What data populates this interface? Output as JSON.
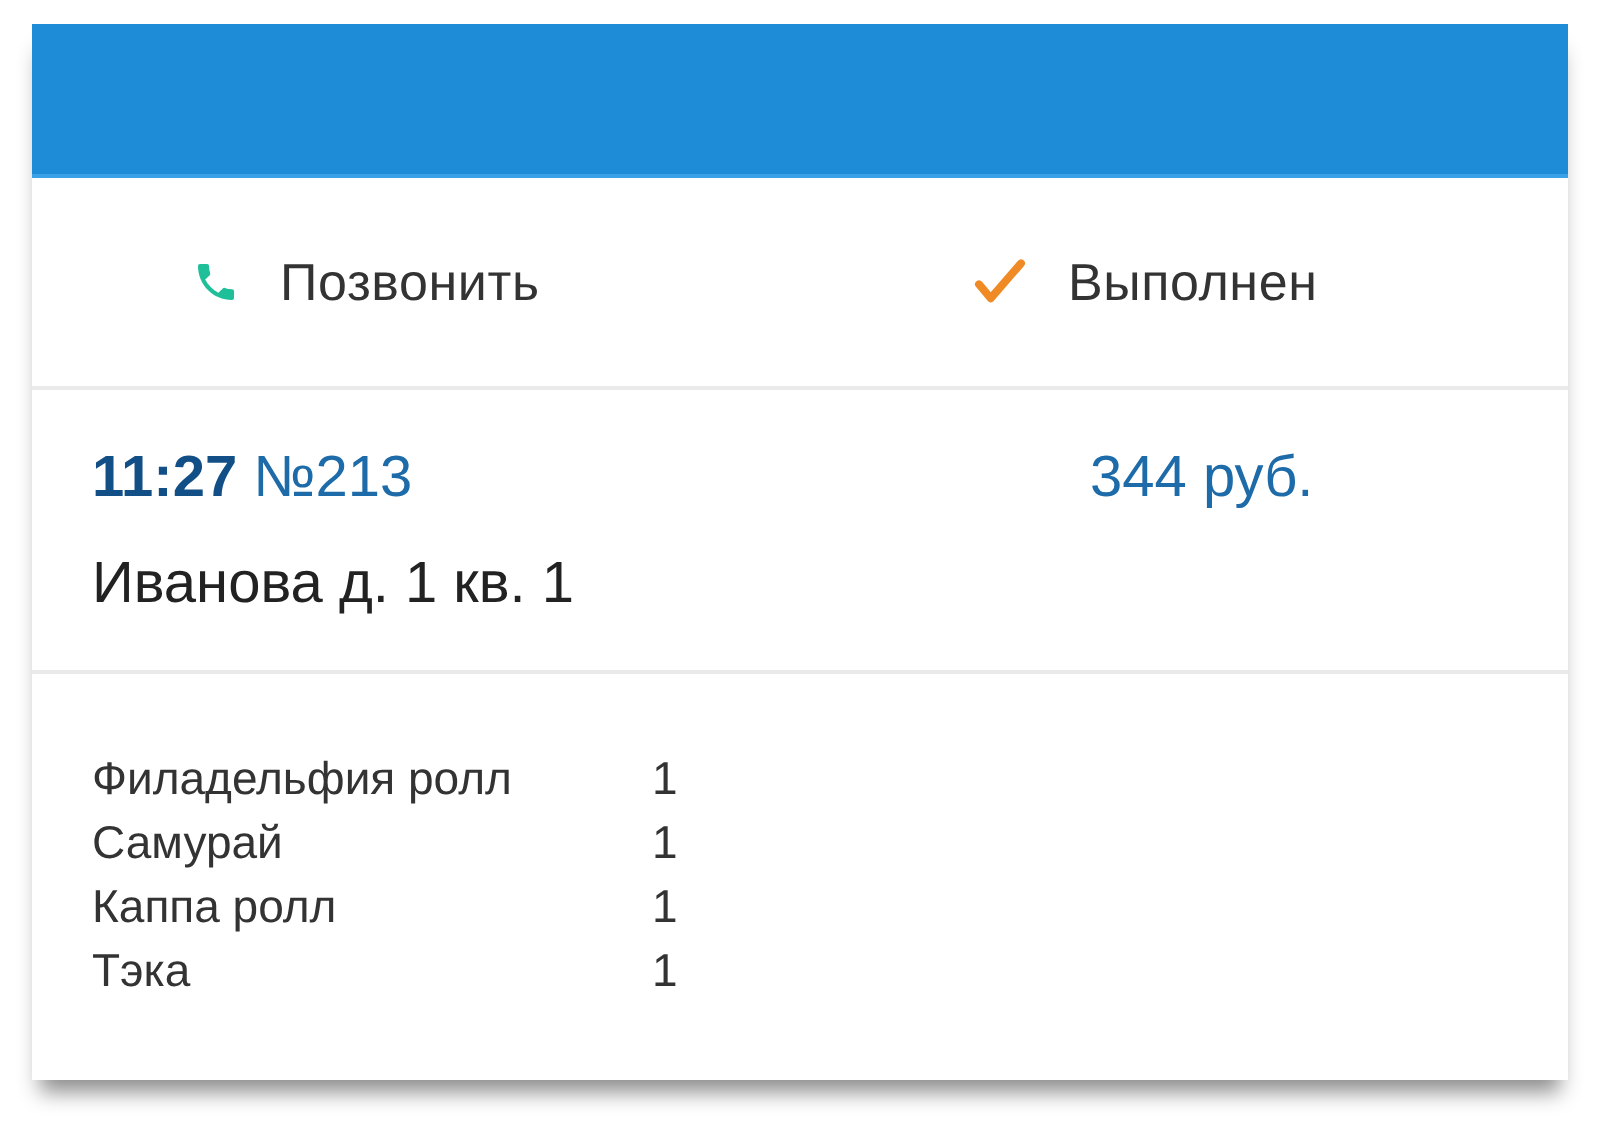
{
  "actions": [
    {
      "kind": "call",
      "label": "Позвонить"
    },
    {
      "kind": "done",
      "label": "Выполнен"
    }
  ],
  "order": {
    "title": "**11:27** №213",
    "total": "344 руб.",
    "address": "Иванова д. 1 кв. 1"
  },
  "items": [
    {
      "name": "Филадельфия ролл",
      "qty": "1"
    },
    {
      "name": "Самурай",
      "qty": "1"
    },
    {
      "name": "Каппа ролл",
      "qty": "1"
    },
    {
      "name": "Тэка",
      "qty": "1"
    }
  ]
}
